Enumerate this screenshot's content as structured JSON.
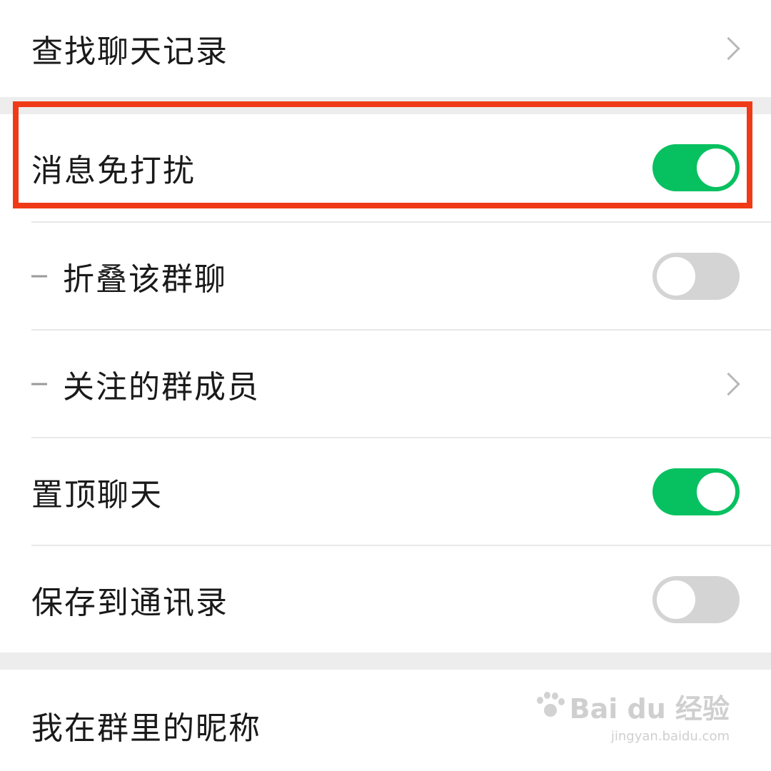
{
  "settings": {
    "search_history": "查找聊天记录",
    "mute_notifications": "消息免打扰",
    "fold_group": "折叠该群聊",
    "followed_members": "关注的群成员",
    "pin_chat": "置顶聊天",
    "save_to_contacts": "保存到通讯录",
    "my_group_nickname": "我在群里的昵称"
  },
  "toggles": {
    "mute_notifications": true,
    "fold_group": false,
    "pin_chat": true,
    "save_to_contacts": false
  },
  "watermark": {
    "brand": "Bai du 经验",
    "domain": "jingyan.baidu.com"
  },
  "colors": {
    "toggle_on": "#07c160",
    "toggle_off": "#d4d4d4",
    "highlight_border": "#f03a17",
    "section_gap": "#ededed"
  }
}
